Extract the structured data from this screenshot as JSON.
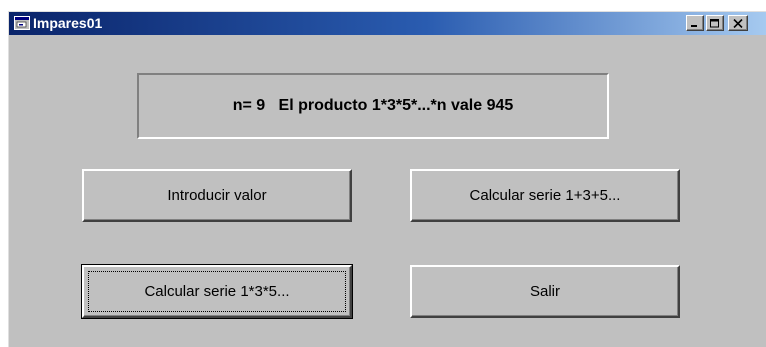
{
  "window": {
    "title": "Impares01",
    "app_icon": "vb-form-icon",
    "controls": {
      "minimize_icon": "minimize-icon",
      "maximize_icon": "maximize-icon",
      "close_icon": "close-icon"
    }
  },
  "display": {
    "text": "n= 9   El producto 1*3*5*...*n vale 945"
  },
  "buttons": {
    "introducir": "Introducir valor",
    "serie_suma": "Calcular serie 1+3+5...",
    "serie_producto": "Calcular serie 1*3*5...",
    "salir": "Salir"
  },
  "colors": {
    "titlebar_start": "#0a246a",
    "titlebar_end": "#a6caf0",
    "face": "#c0c0c0"
  }
}
